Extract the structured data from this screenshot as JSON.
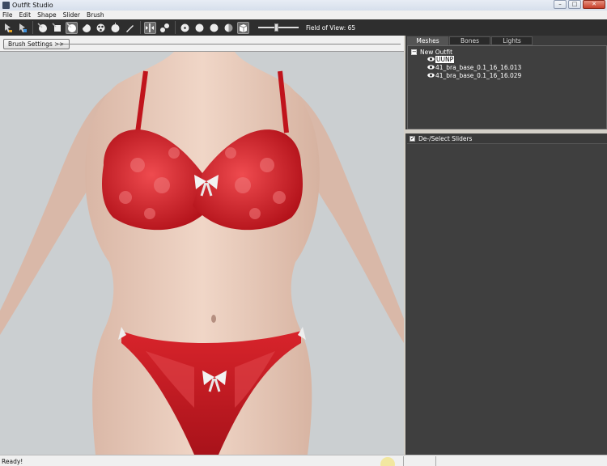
{
  "window": {
    "title": "Outfit Studio",
    "controls": {
      "minimize": "–",
      "maximize": "□",
      "close": "✕"
    }
  },
  "menu": [
    "File",
    "Edit",
    "Shape",
    "Slider",
    "Brush"
  ],
  "toolbar": {
    "tools": [
      "select-icon",
      "transform-icon",
      "inflate-brush-icon",
      "deflate-brush-icon",
      "move-brush-icon",
      "smooth-brush-icon",
      "mask-brush-icon",
      "unmask-brush-icon",
      "weight-brush-icon",
      "color-brush-icon",
      "mirror-icon",
      "connect-icon",
      "render-point-icon",
      "render-solid-icon",
      "render-smooth-icon",
      "render-textured-icon",
      "render-lit-icon",
      "render-box-icon"
    ],
    "field_of_view_label": "Field of View: 65",
    "field_of_view": 65
  },
  "brush_bar": {
    "button": "Brush Settings >>"
  },
  "panel": {
    "tabs": [
      "Meshes",
      "Bones",
      "Lights"
    ],
    "active_tab": "Meshes",
    "tree": {
      "root": "New Outfit",
      "expander": "−",
      "items": [
        "UUNP",
        "41_bra_base_0.1_16_16.013",
        "41_bra_base_0.1_16_16.029"
      ],
      "selected": "UUNP"
    },
    "sliders_header": "De-/Select Sliders",
    "sliders_checked": "✓"
  },
  "status": {
    "text": "Ready!"
  },
  "colors": {
    "toolbar": "#2e2e2e",
    "panel": "#3c3c3c",
    "viewport": "#cbcfd1",
    "lingerie": "#d51e24"
  }
}
